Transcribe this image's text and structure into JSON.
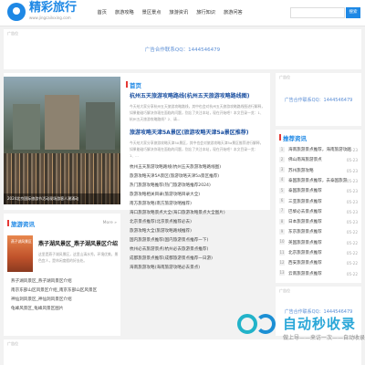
{
  "header": {
    "brand": "精彩旅行",
    "brand_sub": "www.jingcailvxing.com",
    "nav": [
      "首页",
      "旅游攻略",
      "景区景点",
      "旅游资讯",
      "旅行知识",
      "旅游问答"
    ],
    "search_btn": "搜索"
  },
  "ads": {
    "tag": "广告位",
    "text": "广告合作联系QQ：1444546479"
  },
  "sections": {
    "first": "首页",
    "travel_news": "旅游资讯",
    "recommend": "推荐资讯",
    "more": "More »"
  },
  "photo_caption": "2024北京国际旅游节活动现场游客人潮涌动",
  "headlines": [
    {
      "title": "杭州五天旅游攻略路线(杭州五天旅游攻略路线图)",
      "desc": "今天给大家分享杭州五天旅游攻略路线，其中也会对杭州五天旅游攻略路线图进行解释，如果能碰巧解决你现在面临的问题，别忘了关注本站，现在开始吧！本文目录一览：1、杭州五天旅游攻略路线？2、请..."
    },
    {
      "title": "旅游攻略天津5A景区(旅游攻略天津5a景区推荐)",
      "desc": "今天给大家分享旅游攻略天津5A景区，其中也会对旅游攻略天津5a景区推荐进行解释，如果能碰巧解决你现在面临的问题，别忘了关注本站，现在开始吧！本文目录一览：1、..."
    }
  ],
  "middle_list": [
    {
      "text": "杭州五天旅游攻略路线(杭州五天旅游攻略路线图)",
      "date": ""
    },
    {
      "text": "旅游攻略天津5A景区(旅游攻略天津5a景区推荐)",
      "date": ""
    },
    {
      "text": "热门旅游攻略推荐(热门旅游攻略推荐2024)",
      "date": ""
    },
    {
      "text": "旅游攻略相关目录(旅游攻略目录大全)",
      "date": ""
    },
    {
      "text": "南方旅游攻略(南方旅游攻略推荐)",
      "date": ""
    },
    {
      "text": "海口旅游攻略景点大全(海口旅游攻略景点大全图片)",
      "date": ""
    },
    {
      "text": "北京景点推荐(北京景点推荐必去)",
      "date": ""
    },
    {
      "text": "旅游攻略大全(旅游攻略路线推荐)",
      "date": ""
    },
    {
      "text": "国内旅游景点推荐(国内旅游景点推荐一下)",
      "date": ""
    },
    {
      "text": "杭州必去旅游景点(杭州必去旅游景点推荐)",
      "date": ""
    },
    {
      "text": "成都旅游景点推荐(成都旅游景点推荐一日游)",
      "date": ""
    },
    {
      "text": "海南旅游攻略(海南旅游攻略必去景点)",
      "date": ""
    }
  ],
  "travel_news_card": {
    "title": "燕子湖风景区_燕子湖风景区介绍",
    "img_caption": "燕子湖风景区",
    "desc": "这里是燕子湖风景区，这里山清水秀，环境优美，景色宜人，是休闲度假的好去处。"
  },
  "travel_news_list": [
    {
      "text": "燕子湖风景区_燕子湖风景区介绍",
      "date": ""
    },
    {
      "text": "南京东部山区风景区介绍_南京东部山区风景区",
      "date": ""
    },
    {
      "text": "神仙洞风景区_神仙洞风景区介绍",
      "date": ""
    },
    {
      "text": "龟峰风景区_龟峰风景区图片",
      "date": ""
    }
  ],
  "recommend_list": [
    {
      "text": "海南旅游景点推荐，海南旅游攻略",
      "date": "05-23"
    },
    {
      "text": "佛山南海旅游景点",
      "date": "05-23"
    },
    {
      "text": "苏州旅游攻略",
      "date": "05-23"
    },
    {
      "text": "泰国旅游景点推荐，去泰国旅游",
      "date": "05-23"
    },
    {
      "text": "泰国旅游景点推荐",
      "date": "05-23"
    },
    {
      "text": "三亚旅游景点推荐",
      "date": "05-23"
    },
    {
      "text": "巴黎必去景点推荐",
      "date": "05-23"
    },
    {
      "text": "日本旅游景点推荐",
      "date": "05-23"
    },
    {
      "text": "东京旅游景点推荐",
      "date": "05-22"
    },
    {
      "text": "英国旅游景点推荐",
      "date": "05-22"
    },
    {
      "text": "北京旅游景点推荐",
      "date": "05-22"
    },
    {
      "text": "西安旅游景点推荐",
      "date": "05-22"
    },
    {
      "text": "云南旅游景点推荐",
      "date": "05-22"
    }
  ],
  "watermark": {
    "title": "自动秒收录",
    "sub": "做上导——来访一次——自动收录"
  }
}
